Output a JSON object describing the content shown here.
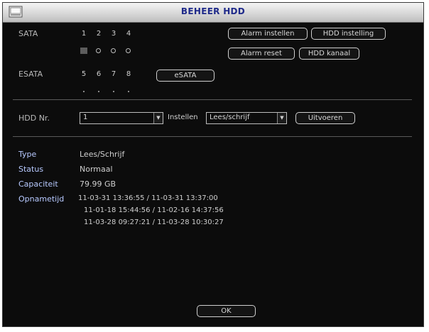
{
  "window": {
    "title": "BEHEER HDD"
  },
  "sata": {
    "label": "SATA",
    "ports": [
      "1",
      "2",
      "3",
      "4"
    ]
  },
  "esata": {
    "label": "ESATA",
    "ports": [
      "5",
      "6",
      "7",
      "8"
    ],
    "button": "eSATA"
  },
  "actions": {
    "alarm_instellen": "Alarm instellen",
    "hdd_instelling": "HDD instelling",
    "alarm_reset": "Alarm reset",
    "hdd_kanaal": "HDD kanaal"
  },
  "controls": {
    "hdd_nr_label": "HDD Nr.",
    "hdd_nr_value": "1",
    "instellen_label": "Instellen",
    "instellen_value": "Lees/schrijf",
    "uitvoeren": "Uitvoeren"
  },
  "info": {
    "type_label": "Type",
    "type_value": "Lees/Schrijf",
    "status_label": "Status",
    "status_value": "Normaal",
    "capaciteit_label": "Capaciteit",
    "capaciteit_value": "79.99 GB",
    "opnametijd_label": "Opnametijd",
    "records": [
      "11-03-31 13:36:55 / 11-03-31 13:37:00",
      "11-01-18 15:44:56 / 11-02-16 14:37:56",
      "11-03-28 09:27:21 / 11-03-28 10:30:27"
    ]
  },
  "ok_button": "OK",
  "icons": {
    "app": "hdd-window-icon",
    "dropdown": "chevron-down-icon"
  }
}
